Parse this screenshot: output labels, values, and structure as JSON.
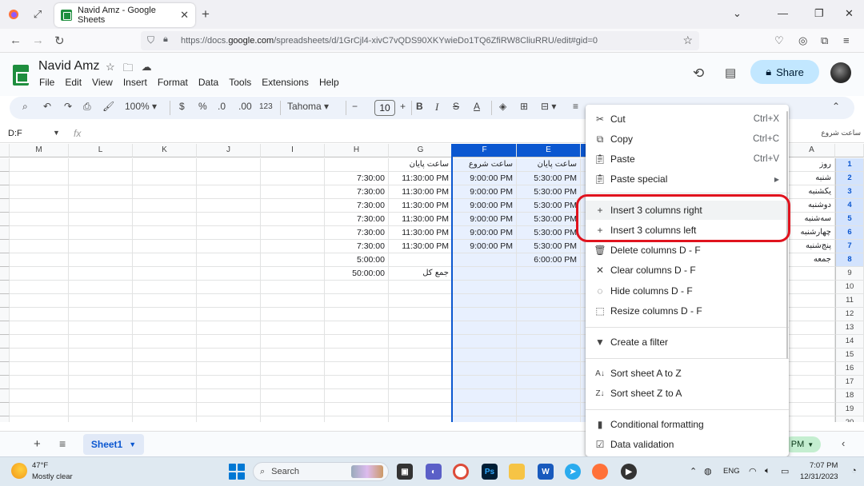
{
  "browser": {
    "tab_title": "Navid Amz - Google Sheets",
    "url_pre": "https://docs.",
    "url_domain": "google.com",
    "url_post": "/spreadsheets/d/1GrCjl4-xivC7vQDS90XKYwieDo1TQ6ZfiRW8CliuRRU/edit#gid=0"
  },
  "sheets": {
    "doc_title": "Navid Amz",
    "menu": [
      "File",
      "Edit",
      "View",
      "Insert",
      "Format",
      "Data",
      "Tools",
      "Extensions",
      "Help"
    ],
    "share_label": "Share"
  },
  "toolbar": {
    "zoom": "100%",
    "currency": "$",
    "percent": "%",
    "decimal_dec": ".0",
    "decimal_inc": ".00",
    "format_123": "123",
    "font": "Tahoma",
    "font_size": "10"
  },
  "formula": {
    "name_box": "D:F",
    "formula_partial": "ساعت شروع"
  },
  "grid": {
    "col_headers": [
      "M",
      "L",
      "K",
      "J",
      "I",
      "H",
      "G",
      "F",
      "E",
      "",
      "A"
    ],
    "row_numbers": [
      "1",
      "2",
      "3",
      "4",
      "5",
      "6",
      "7",
      "8",
      "9",
      "10",
      "11",
      "12",
      "13",
      "14",
      "15",
      "16",
      "17",
      "18",
      "19",
      "20"
    ],
    "col_G_header": "ساعت پایان",
    "col_F_header": "ساعت شروع",
    "col_E_header": "ساعت پایان",
    "days": [
      "روز",
      "شنبه",
      "یکشنبه",
      "دوشنبه",
      "سه‌شنبه",
      "چهارشنبه",
      "پنج‌شنبه",
      "جمعه"
    ],
    "col_H": [
      "7:30:00",
      "7:30:00",
      "7:30:00",
      "7:30:00",
      "7:30:00",
      "7:30:00",
      "5:00:00",
      "50:00:00"
    ],
    "col_G": [
      "11:30:00 PM",
      "11:30:00 PM",
      "11:30:00 PM",
      "11:30:00 PM",
      "11:30:00 PM",
      "11:30:00 PM"
    ],
    "col_F": [
      "9:00:00 PM",
      "9:00:00 PM",
      "9:00:00 PM",
      "9:00:00 PM",
      "9:00:00 PM",
      "9:00:00 PM"
    ],
    "col_E": [
      "5:30:00 PM",
      "5:30:00 PM",
      "5:30:00 PM",
      "5:30:00 PM",
      "5:30:00 PM",
      "5:30:00 PM",
      "6:00:00 PM"
    ],
    "total_label": "جمع کل"
  },
  "context_menu": {
    "cut": "Cut",
    "cut_sc": "Ctrl+X",
    "copy": "Copy",
    "copy_sc": "Ctrl+C",
    "paste": "Paste",
    "paste_sc": "Ctrl+V",
    "paste_special": "Paste special",
    "insert_right": "Insert 3 columns right",
    "insert_left": "Insert 3 columns left",
    "delete_cols": "Delete columns D - F",
    "clear_cols": "Clear columns D - F",
    "hide_cols": "Hide columns D - F",
    "resize_cols": "Resize columns D - F",
    "create_filter": "Create a filter",
    "sort_az": "Sort sheet A to Z",
    "sort_za": "Sort sheet Z to A",
    "cond_format": "Conditional formatting",
    "data_validation": "Data validation"
  },
  "sheet_tabs": {
    "active": "Sheet1",
    "explore_partial": "PM"
  },
  "taskbar": {
    "temp": "47°F",
    "weather": "Mostly clear",
    "search": "Search",
    "lang": "ENG",
    "time": "7:07 PM",
    "date": "12/31/2023"
  },
  "colors": {
    "selection": "#0b57d0",
    "selection_fill": "#e8f0fe",
    "highlight_ring": "#e0131e",
    "share_bg": "#c2e7ff"
  }
}
